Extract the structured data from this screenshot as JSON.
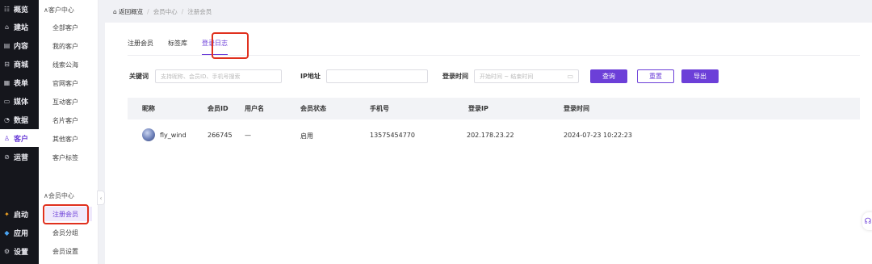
{
  "rail": {
    "items": [
      {
        "icon": "☷",
        "label": "概览"
      },
      {
        "icon": "⌂",
        "label": "建站"
      },
      {
        "icon": "▤",
        "label": "内容"
      },
      {
        "icon": "⊟",
        "label": "商城"
      },
      {
        "icon": "▦",
        "label": "表单"
      },
      {
        "icon": "▭",
        "label": "媒体"
      },
      {
        "icon": "◔",
        "label": "数据"
      },
      {
        "icon": "♙",
        "label": "客户"
      },
      {
        "icon": "⊘",
        "label": "运营"
      },
      {
        "icon": "✦",
        "label": "启动"
      },
      {
        "icon": "◆",
        "label": "应用"
      },
      {
        "icon": "⚙",
        "label": "设置"
      }
    ]
  },
  "sidebar": {
    "group1": "∧客户中心",
    "group1_items": [
      "全部客户",
      "我的客户",
      "线索公海",
      "官网客户",
      "互动客户",
      "名片客户",
      "其他客户",
      "客户标签"
    ],
    "group2": "∧会员中心",
    "group2_items": [
      "注册会员",
      "会员分组",
      "会员设置"
    ]
  },
  "breadcrumb": {
    "home": "返回概览",
    "sep": "/",
    "level1": "会员中心",
    "level2": "注册会员"
  },
  "tabs": [
    "注册会员",
    "标签库",
    "登录日志"
  ],
  "filters": {
    "keyword_label": "关键词",
    "keyword_placeholder": "支持昵称、会员ID、手机号搜索",
    "ip_label": "IP地址",
    "time_label": "登录时间",
    "time_placeholder": "开始时间 ~ 结束时间",
    "search_button": "查询",
    "reset_button": "重置",
    "export_button": "导出"
  },
  "table": {
    "columns": [
      "昵称",
      "会员ID",
      "用户名",
      "会员状态",
      "手机号",
      "登录IP",
      "登录时间"
    ],
    "rows": [
      {
        "nickname": "fly_wind",
        "member_id": "266745",
        "username": "—",
        "status": "启用",
        "phone": "13575454770",
        "ip": "202.178.23.22",
        "login_time": "2024-07-23 10:22:23"
      }
    ]
  },
  "colors": {
    "accent": "#6c3fd8",
    "highlight": "#e0301e",
    "rail_bg": "#15161c"
  }
}
